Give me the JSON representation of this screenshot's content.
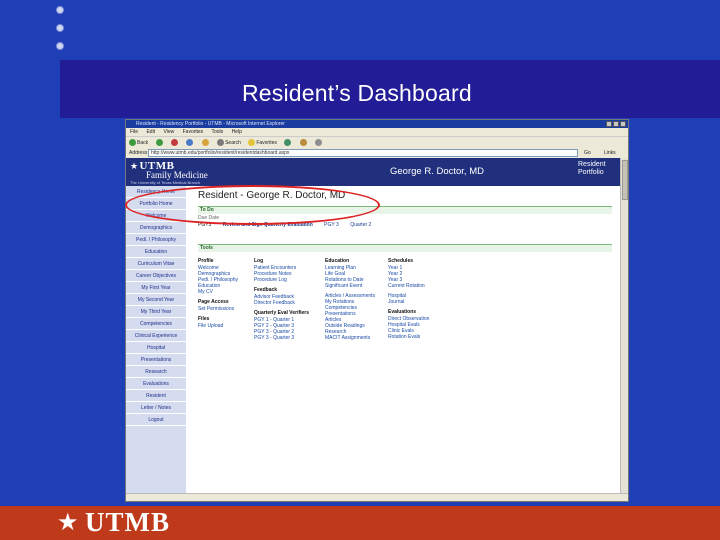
{
  "slide": {
    "title": "Resident’s Dashboard",
    "brand": "UTMB",
    "colors": {
      "background": "#1f3fb7",
      "title_band": "#221c97",
      "footer": "#bf3a1a"
    }
  },
  "browser": {
    "title": "Resident - Residency Portfolio - UTMB - Microsoft Internet Explorer",
    "menu": [
      "File",
      "Edit",
      "View",
      "Favorites",
      "Tools",
      "Help"
    ],
    "toolbar": {
      "back": "Back",
      "search": "Search",
      "favorites": "Favorites"
    },
    "address_label": "Address",
    "address": "http://www.utmb.edu/portfolio/resident/residentdashboard.aspx",
    "go": "Go",
    "links": "Links"
  },
  "page": {
    "logo_brand": "UTMB",
    "logo_dept": "Family Medicine",
    "logo_univ": "The University of Texas Medical Branch",
    "header_name": "George R. Doctor, MD",
    "header_portfolio": "Resident Portfolio",
    "resident_heading": "Resident - George R. Doctor, MD",
    "sidebar": [
      "Residency Home",
      "Portfolio Home",
      "Welcome",
      "Demographics",
      "Pedi. / Philosophy",
      "Education",
      "Curriculum Vitae",
      "Career Objectives",
      "My First Year",
      "My Second Year",
      "My Third Year",
      "Competencies",
      "Clinical Experience",
      "Hospital",
      "Presentations",
      "Research",
      "Evaluations",
      "Resident",
      "Letter / Notes",
      "Logout"
    ],
    "todo": {
      "label": "To Do",
      "col_label": "Due Date",
      "row": {
        "type": "PGY3",
        "task": "Review and Sign Quarterly Evaluation",
        "year": "PGY 3",
        "quarter": "Quarter 2"
      }
    },
    "tools": {
      "label": "Tools",
      "columns": [
        {
          "heading": "Profile",
          "items": [
            "Welcome",
            "Demographics",
            "Pedi. / Philosophy",
            "Education",
            "My CV"
          ],
          "sub": [
            {
              "heading": "Page Access",
              "items": [
                "Set Permissions"
              ]
            },
            {
              "heading": "Files",
              "items": [
                "File Upload"
              ]
            }
          ]
        },
        {
          "heading": "Log",
          "items": [
            "Patient Encounters",
            "Procedure Notes",
            "Procedure Log"
          ],
          "sub": [
            {
              "heading": "Feedback",
              "items": [
                "Advisor Feedback",
                "Director Feedback"
              ]
            },
            {
              "heading": "Quarterly Eval Verifiers",
              "items": [
                "PGY 1 - Quarter 1",
                "PGY 2 - Quarter 3",
                "PGY 3 - Quarter 2",
                "PGY 3 - Quarter 3"
              ]
            }
          ]
        },
        {
          "heading": "Education",
          "items": [
            "Learning Plan",
            "Life Goal",
            "Rotations to Date",
            "Significant Event",
            "Articles / Assessments",
            "My Rotations",
            "Competencies",
            "Presentations",
            "Articles",
            "Outside Readings",
            "Research",
            "MACIT Assignments"
          ]
        },
        {
          "heading": "Schedules",
          "items": [
            "Year 1",
            "Year 2",
            "Year 3",
            "Current Rotation",
            "Hospital",
            "Journal"
          ],
          "sub": [
            {
              "heading": "Evaluations",
              "items": [
                "Direct Observation",
                "Hospital Evals",
                "Clinic Evals",
                "Rotation Evals"
              ]
            }
          ]
        }
      ]
    }
  }
}
